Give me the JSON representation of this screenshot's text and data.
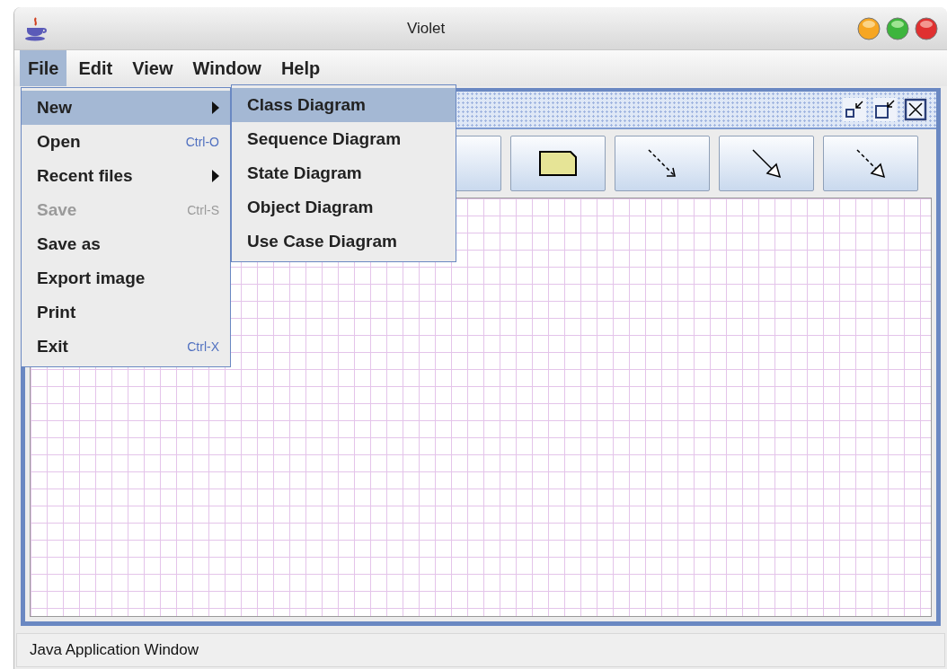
{
  "window": {
    "title": "Violet"
  },
  "menu_bar": [
    {
      "label": "File",
      "selected": true
    },
    {
      "label": "Edit",
      "selected": false
    },
    {
      "label": "View",
      "selected": false
    },
    {
      "label": "Window",
      "selected": false
    },
    {
      "label": "Help",
      "selected": false
    }
  ],
  "file_menu": [
    {
      "label": "New",
      "submenu": true,
      "selected": true,
      "disabled": false
    },
    {
      "label": "Open",
      "shortcut": "Ctrl-O",
      "submenu": false,
      "selected": false,
      "disabled": false
    },
    {
      "label": "Recent files",
      "submenu": true,
      "selected": false,
      "disabled": false
    },
    {
      "label": "Save",
      "shortcut": "Ctrl-S",
      "submenu": false,
      "selected": false,
      "disabled": true
    },
    {
      "label": "Save as",
      "submenu": false,
      "selected": false,
      "disabled": false
    },
    {
      "label": "Export image",
      "submenu": false,
      "selected": false,
      "disabled": false
    },
    {
      "label": "Print",
      "submenu": false,
      "selected": false,
      "disabled": false
    },
    {
      "label": "Exit",
      "shortcut": "Ctrl-X",
      "submenu": false,
      "selected": false,
      "disabled": false
    }
  ],
  "new_submenu": [
    {
      "label": "Class Diagram",
      "selected": true
    },
    {
      "label": "Sequence Diagram",
      "selected": false
    },
    {
      "label": "State Diagram",
      "selected": false
    },
    {
      "label": "Object Diagram",
      "selected": false
    },
    {
      "label": "Use Case Diagram",
      "selected": false
    }
  ],
  "toolbar": [
    {
      "kind": "blank"
    },
    {
      "kind": "note"
    },
    {
      "kind": "dashed_arrow"
    },
    {
      "kind": "triangle_arrow"
    },
    {
      "kind": "dashed_triangle_arrow"
    }
  ],
  "status_bar": {
    "text": "Java Application Window"
  }
}
